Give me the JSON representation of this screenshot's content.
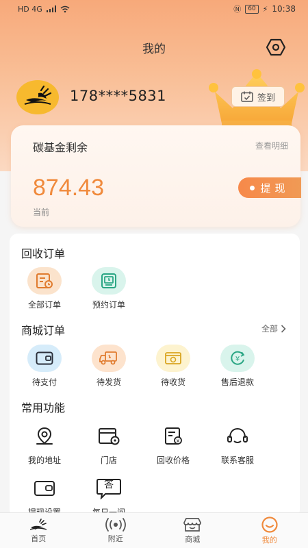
{
  "status_bar": {
    "network": "HD 4G",
    "battery": "60",
    "time": "10:38"
  },
  "header": {
    "title": "我的"
  },
  "profile": {
    "phone": "178****5831",
    "signin_label": "签到"
  },
  "carbon_card": {
    "title": "碳基金剩余",
    "detail_link": "查看明细",
    "amount": "874.43",
    "sub_label": "当前",
    "withdraw_label": "提现"
  },
  "recycle_orders": {
    "title": "回收订单",
    "items": [
      {
        "label": "全部订单",
        "icon": "order-list-icon"
      },
      {
        "label": "预约订单",
        "icon": "reserve-icon"
      }
    ]
  },
  "mall_orders": {
    "title": "商城订单",
    "more_label": "全部",
    "items": [
      {
        "label": "待支付",
        "icon": "wallet-icon"
      },
      {
        "label": "待发货",
        "icon": "truck-icon"
      },
      {
        "label": "待收货",
        "icon": "package-icon"
      },
      {
        "label": "售后退款",
        "icon": "refund-icon"
      }
    ]
  },
  "common_functions": {
    "title": "常用功能",
    "items": [
      {
        "label": "我的地址",
        "icon": "location-icon"
      },
      {
        "label": "门店",
        "icon": "store-icon"
      },
      {
        "label": "回收价格",
        "icon": "price-icon"
      },
      {
        "label": "联系客服",
        "icon": "headset-icon"
      },
      {
        "label": "提现设置",
        "icon": "withdraw-setting-icon"
      },
      {
        "label": "每日一问",
        "icon": "answer-icon"
      }
    ],
    "answer_glyph": "答"
  },
  "tabbar": {
    "items": [
      {
        "label": "首页"
      },
      {
        "label": "附近"
      },
      {
        "label": "商城"
      },
      {
        "label": "我的"
      }
    ],
    "active_color": "#f08a3c"
  },
  "colors": {
    "accent": "#f08a3c",
    "hero_top": "#f7a97a"
  }
}
